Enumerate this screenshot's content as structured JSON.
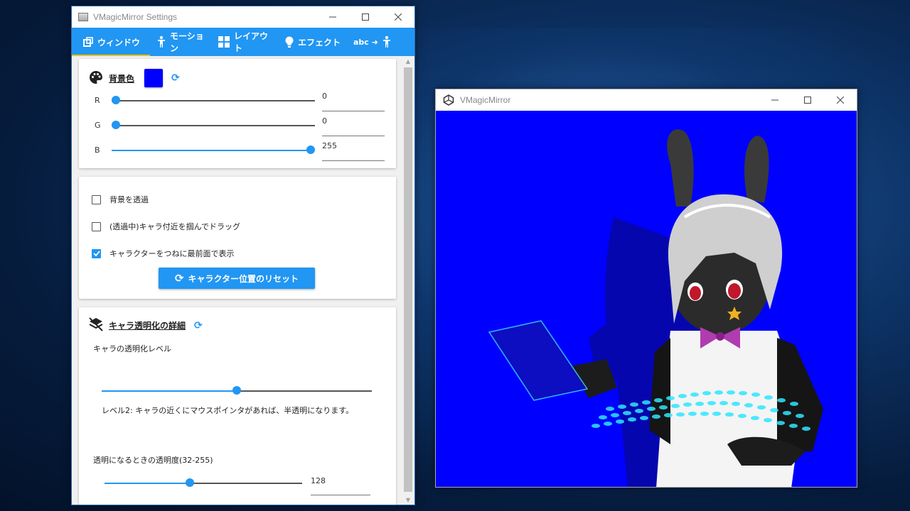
{
  "settings_window": {
    "title": "VMagicMirror Settings",
    "tabs": [
      {
        "label": "ウィンドウ",
        "icon": "window-icon",
        "active": true
      },
      {
        "label": "モーション",
        "icon": "person-icon"
      },
      {
        "label": "レイアウト",
        "icon": "layout-icon"
      },
      {
        "label": "エフェクト",
        "icon": "lightbulb-icon"
      },
      {
        "label": "abc ➜",
        "icon": "word-to-motion-icon"
      }
    ],
    "background": {
      "header": "背景色",
      "color": "#0000ff",
      "r_label": "R",
      "r_value": "0",
      "r_level": 0.0,
      "g_label": "G",
      "g_value": "0",
      "g_level": 0.0,
      "b_label": "B",
      "b_value": "255",
      "b_level": 1.0
    },
    "window_options": {
      "transparent_label": "背景を透過",
      "transparent_checked": false,
      "drag_label": "(透過中)キャラ付近を掴んでドラッグ",
      "drag_checked": false,
      "topmost_label": "キャラクターをつねに最前面で表示",
      "topmost_checked": true,
      "reset_button": "キャラクター位置のリセット"
    },
    "transparency": {
      "header": "キャラ透明化の詳細",
      "level_label": "キャラの透明化レベル",
      "level_fraction": 0.5,
      "level_description": "レベル2: キャラの近くにマウスポインタがあれば、半透明になります。",
      "alpha_label": "透明になるときの透明度(32-255)",
      "alpha_value": "128",
      "alpha_fraction": 0.4
    }
  },
  "vmm_window": {
    "title": "VMagicMirror",
    "background_color": "#0000ff"
  }
}
